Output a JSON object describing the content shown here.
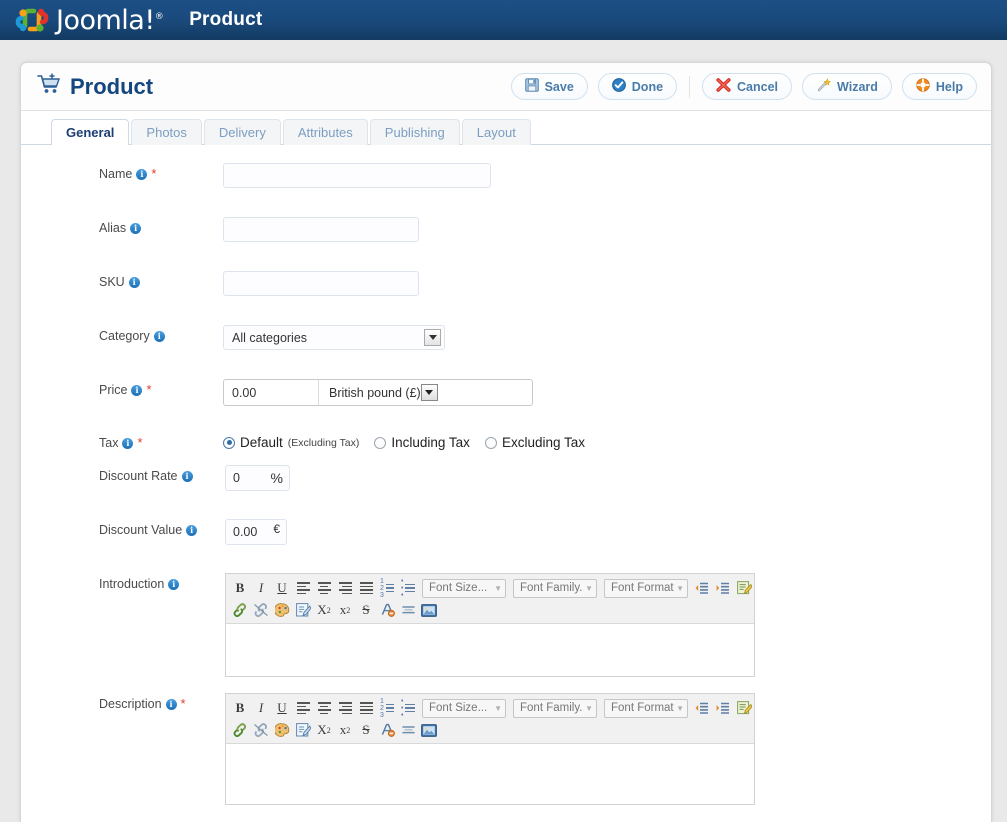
{
  "topbar": {
    "brand": "Joomla!",
    "registered": "®",
    "title": "Product",
    "logo_icon": "joomla-logo-icon",
    "bg_color": "#1a4a7c"
  },
  "page": {
    "title": "Product",
    "title_icon": "shopping-cart-icon",
    "title_color": "#14477d"
  },
  "toolbar": {
    "buttons": [
      {
        "label": "Save",
        "icon": "floppy-disk-icon"
      },
      {
        "label": "Done",
        "icon": "check-circle-icon"
      },
      {
        "label": "Cancel",
        "icon": "red-x-icon"
      },
      {
        "label": "Wizard",
        "icon": "magic-wand-icon"
      },
      {
        "label": "Help",
        "icon": "lifebuoy-icon"
      }
    ]
  },
  "tabs": [
    {
      "label": "General",
      "active": true
    },
    {
      "label": "Photos",
      "active": false
    },
    {
      "label": "Delivery",
      "active": false
    },
    {
      "label": "Attributes",
      "active": false
    },
    {
      "label": "Publishing",
      "active": false
    },
    {
      "label": "Layout",
      "active": false
    }
  ],
  "form": {
    "name": {
      "label": "Name",
      "value": "",
      "required": true,
      "info": true
    },
    "alias": {
      "label": "Alias",
      "value": "",
      "required": false,
      "info": true
    },
    "sku": {
      "label": "SKU",
      "value": "",
      "required": false,
      "info": true
    },
    "category": {
      "label": "Category",
      "value": "All categories",
      "required": false,
      "info": true
    },
    "price": {
      "label": "Price",
      "required": true,
      "info": true,
      "amount": "0.00",
      "currency": "British pound (£)"
    },
    "tax": {
      "label": "Tax",
      "required": true,
      "info": true,
      "options": [
        {
          "label": "Default",
          "note": "(Excluding Tax)",
          "selected": true
        },
        {
          "label": "Including Tax",
          "note": "",
          "selected": false
        },
        {
          "label": "Excluding Tax",
          "note": "",
          "selected": false
        }
      ]
    },
    "discount_rate": {
      "label": "Discount Rate",
      "value": "0",
      "unit": "%",
      "required": false,
      "info": true
    },
    "discount_value": {
      "label": "Discount Value",
      "value": "0.00",
      "unit": "€",
      "required": false,
      "info": true
    },
    "introduction": {
      "label": "Introduction",
      "required": false,
      "info": true,
      "value": ""
    },
    "description": {
      "label": "Description",
      "required": true,
      "info": true,
      "value": ""
    }
  },
  "editor": {
    "row1_icons": [
      "bold-icon",
      "italic-icon",
      "underline-icon",
      "align-left-icon",
      "align-center-icon",
      "align-right-icon",
      "align-justify-icon",
      "ordered-list-icon",
      "unordered-list-icon"
    ],
    "row2_icons": [
      "insert-link-icon",
      "unlink-icon",
      "color-palette-icon",
      "edit-html-icon",
      "subscript-icon",
      "superscript-icon",
      "strikethrough-icon",
      "remove-format-icon",
      "horizontal-rule-icon",
      "insert-image-icon"
    ],
    "selects": [
      {
        "label": "Font Size...",
        "name": "font-size-select"
      },
      {
        "label": "Font Family.",
        "name": "font-family-select"
      },
      {
        "label": "Font Format",
        "name": "font-format-select"
      }
    ],
    "trailing_icons": [
      "outdent-icon",
      "indent-icon",
      "toggle-editor-icon"
    ]
  }
}
